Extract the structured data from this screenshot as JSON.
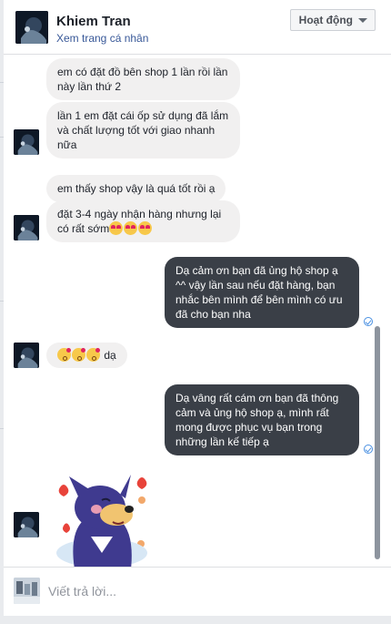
{
  "header": {
    "name": "Khiem Tran",
    "profile_link": "Xem trang cá nhân",
    "status_button": "Hoạt động"
  },
  "messages": [
    {
      "from": "customer",
      "text": "em có đặt đồ bên shop 1 lần rồi lần này lần thứ 2"
    },
    {
      "from": "customer",
      "text": "lần 1 em đặt cái ốp sử dụng đã lắm và chất lượng tốt với giao nhanh nữa"
    },
    {
      "from": "customer",
      "text": "em thấy shop vậy là quá tốt rồi ạ"
    },
    {
      "from": "customer",
      "text": "đặt 3-4 ngày nhận hàng nhưng lại có rất sớm",
      "emojis": [
        "heart-eyes",
        "heart-eyes",
        "heart-eyes"
      ]
    },
    {
      "from": "shop",
      "text": "Dạ cảm ơn bạn đã ủng hộ shop ạ ^^ vậy lần sau nếu đặt hàng, bạn nhắc bên mình để bên mình có ưu đã cho bạn nha",
      "seen": true
    },
    {
      "from": "customer",
      "text": "dạ",
      "emojis": [
        "kiss",
        "kiss",
        "kiss"
      ]
    },
    {
      "from": "shop",
      "text": "Dạ vâng rất cám ơn bạn đã thông cảm và ủng hộ shop ạ, mình rất mong được phục vụ bạn trong những lần kế tiếp ạ",
      "seen": true
    },
    {
      "from": "customer",
      "sticker": "blue-dog-sticker"
    }
  ],
  "composer": {
    "placeholder": "Viết trả lời..."
  },
  "colors": {
    "incoming_bubble": "#f1f0f0",
    "outgoing_bubble": "#3a3f47",
    "link": "#385898",
    "seen_check": "#4a90e2"
  }
}
